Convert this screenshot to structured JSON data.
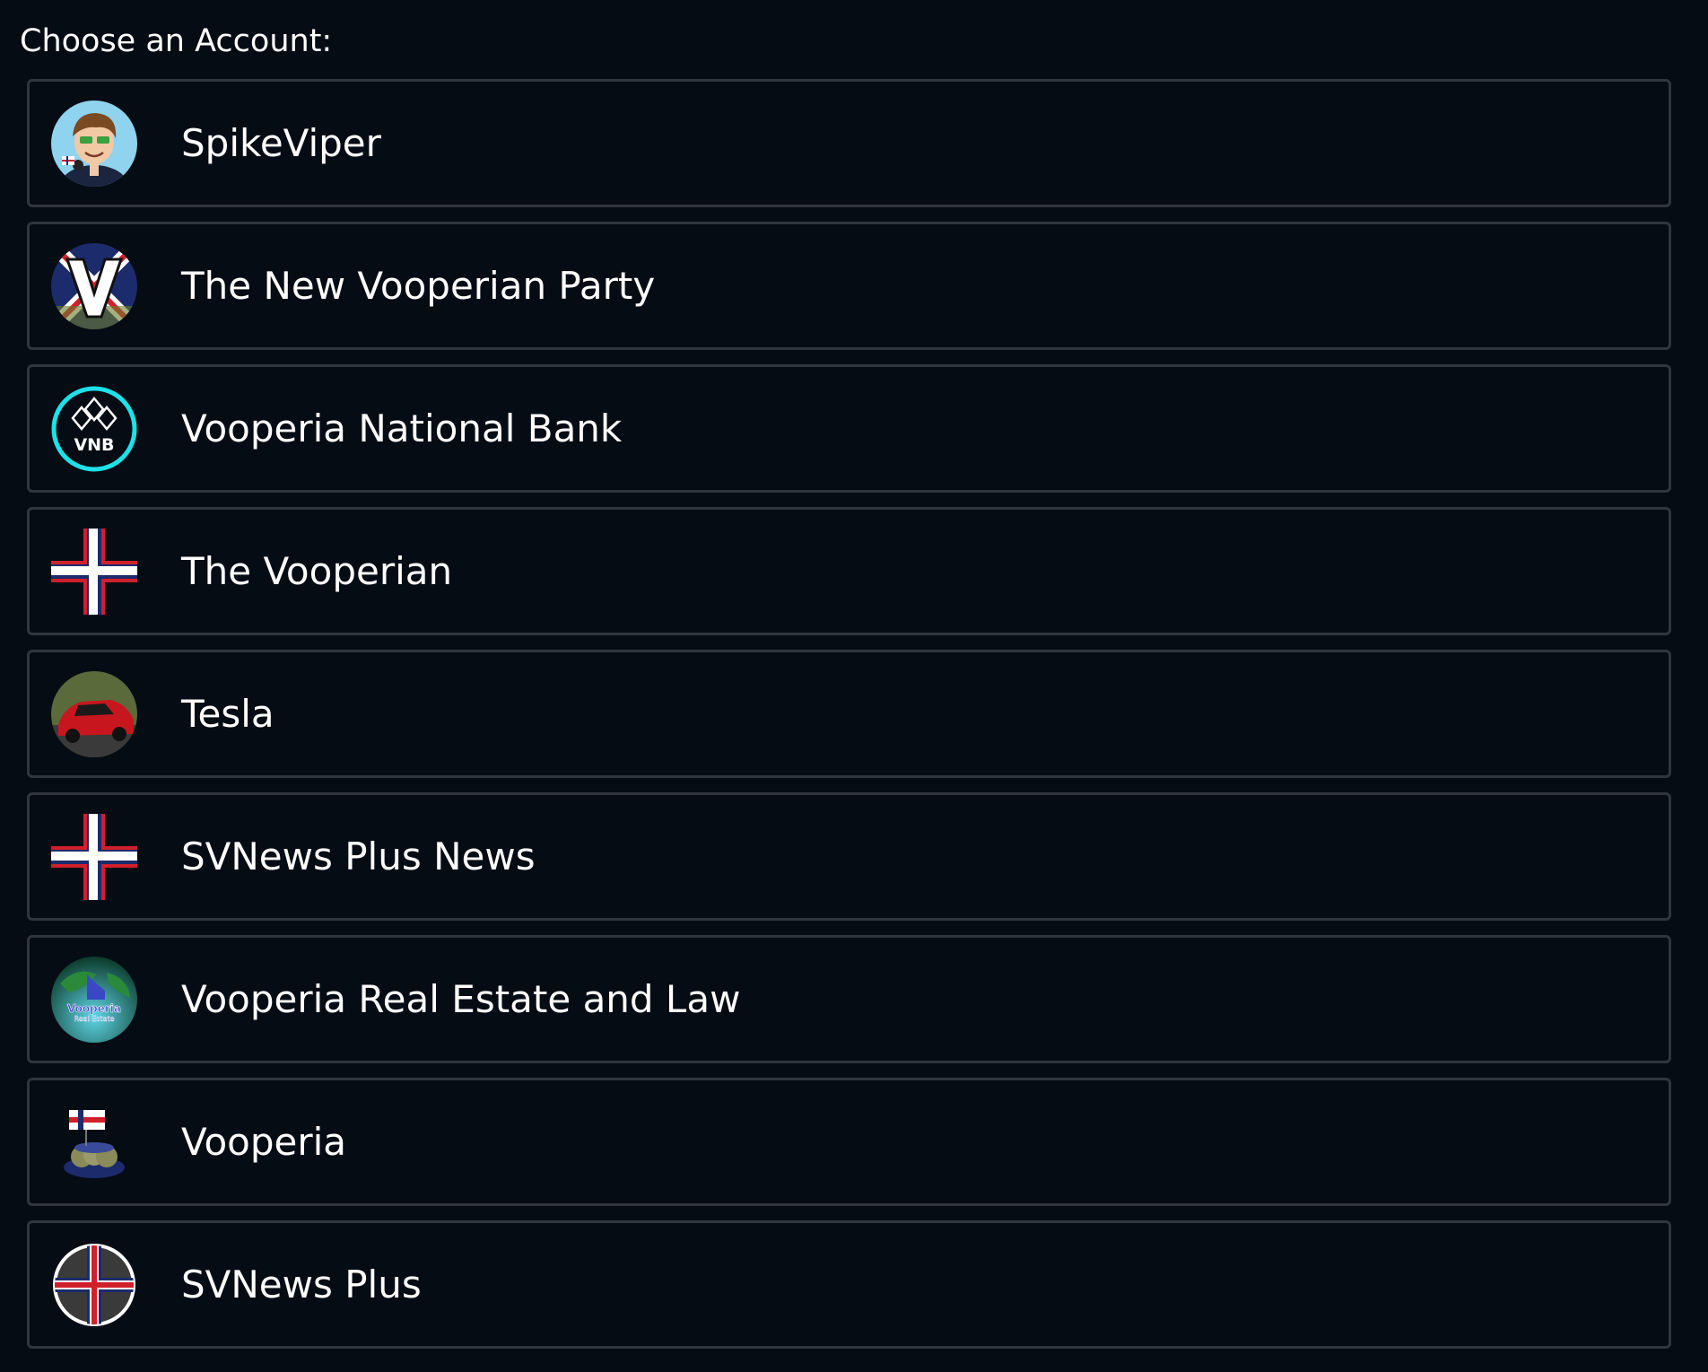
{
  "heading": "Choose an Account:",
  "accounts": [
    {
      "name": "SpikeViper",
      "icon": "spikeviper-avatar-icon"
    },
    {
      "name": "The New Vooperian Party",
      "icon": "party-v-logo-icon"
    },
    {
      "name": "Vooperia National Bank",
      "icon": "vnb-logo-icon",
      "icon_text": "VNB"
    },
    {
      "name": "The Vooperian",
      "icon": "vooperian-cross-icon"
    },
    {
      "name": "Tesla",
      "icon": "red-car-icon"
    },
    {
      "name": "SVNews Plus News",
      "icon": "vooperian-cross-icon"
    },
    {
      "name": "Vooperia Real Estate and Law",
      "icon": "real-estate-globe-icon",
      "icon_text": "Vooperia Real Estate"
    },
    {
      "name": "Vooperia",
      "icon": "vooperia-flag-icon"
    },
    {
      "name": "SVNews Plus",
      "icon": "svnews-plus-cross-icon"
    }
  ],
  "colors": {
    "background": "#050c14",
    "border": "#30363d",
    "accent_cyan": "#1ee0e8",
    "flag_red": "#d0202a",
    "flag_blue": "#1c2b6b"
  }
}
